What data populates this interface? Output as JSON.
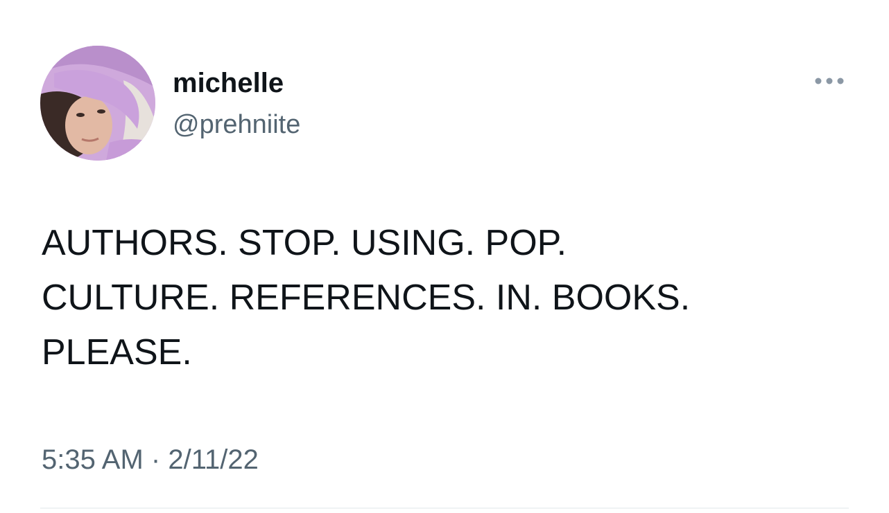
{
  "tweet": {
    "author": {
      "display_name": "michelle",
      "handle": "@prehniite",
      "avatar_icon": "profile-photo"
    },
    "more_icon": "more-horizontal-icon",
    "text_lines": [
      "AUTHORS. STOP. USING. POP.",
      "CULTURE. REFERENCES. IN. BOOKS.",
      "PLEASE."
    ],
    "time": "5:35 AM",
    "separator": "·",
    "date": "2/11/22"
  },
  "colors": {
    "text_primary": "#0f1419",
    "text_secondary": "#536471",
    "background": "#ffffff",
    "divider": "#eff3f4"
  }
}
